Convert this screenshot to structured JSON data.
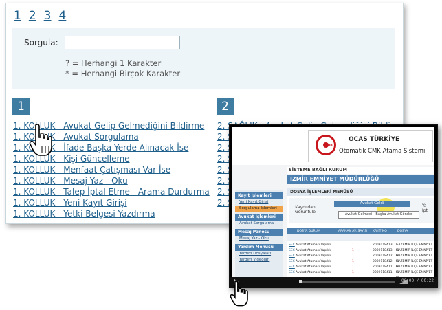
{
  "pager": {
    "pages": [
      "1",
      "2",
      "3",
      "4"
    ]
  },
  "search": {
    "label": "Sorgula:",
    "value": "",
    "hint1": "? = Herhangi 1 Karakter",
    "hint2": "* = Herhangi Birçok Karakter"
  },
  "section1": {
    "badge": "1",
    "items": [
      "1. KOLLUK - Avukat Gelip Gelmediğini Bildirme",
      "1. KOLLUK - Avukat Sorgulama",
      "1. KOLLUK - İfade Başka Yerde Alınacak İse",
      "1. KOLLUK - Kişi Güncelleme",
      "1. KOLLUK - Menfaat Çatışması Var İse",
      "1. KOLLUK - Mesaj Yaz - Oku",
      "1. KOLLUK - Talep İptal Etme - Arama Durdurma",
      "1. KOLLUK - Yeni Kayıt Girişi",
      "1. KOLLUK - Yetki Belgesi Yazdırma"
    ]
  },
  "section2": {
    "badge": "2",
    "items": [
      "2. SAĞLIK - Avukat Gelip Gelmediğini Bildirme",
      "2. S",
      "2. S",
      "2. S",
      "2. S",
      "2. S",
      "2. S",
      "2. S"
    ]
  },
  "video": {
    "logo_title": "OCAS TÜRKİYE",
    "logo_sub": "Otomatik CMK Atama Sistemi",
    "logo_mark": "ocas",
    "top_bar": "SİSTEME BAĞLI KURUM",
    "title_bar": "İZMİR EMNİYET MÜDÜRLÜĞÜ",
    "side_menu": [
      {
        "head": "Kayıt İşlemleri",
        "links": [
          "Yeni Kayıt Girişi",
          "Sorgulama İşlemleri"
        ],
        "active": 1
      },
      {
        "head": "Avukat İşlemleri",
        "links": [
          "Avukat Sorgulama"
        ],
        "active": -1
      },
      {
        "head": "Mesaj Panosu",
        "links": [
          "Mesaj Yaz - Oku"
        ],
        "active": -1
      },
      {
        "head": "Yardım Menüsü",
        "links": [
          "Yardım Dosyaları",
          "Yardım Videoları"
        ],
        "active": -1
      }
    ],
    "dosya_head": "DOSYA İŞLEMLERİ MENÜSÜ",
    "kaydi_label": "Kaydı'dan Görüntüle",
    "btn1": "Avukat Geldi",
    "btn2": "Avukat Gelmedi - Başka Avukat Gönder",
    "right_fragment": "Ya İpt",
    "table_headers": [
      "DOSYA DURUM",
      "ARANAN AV. SAYISI",
      "KAYIT NO",
      "DOSYA"
    ],
    "rows": [
      [
        "SEÇ",
        "Avukat Ataması Yapıldı.",
        "1",
        "2009118413",
        "GAZEMİR İLÇE EMNİYET M"
      ],
      [
        "SEÇ",
        "Avukat Ataması Yapıldı.",
        "1",
        "2009118413",
        "GAZEMİR İLÇE EMNİYET M"
      ],
      [
        "SEÇ",
        "Avukat Ataması Yapıldı.",
        "1",
        "2009118412",
        "GAZEMİR İLÇE EMNİYET M"
      ],
      [
        "SEÇ",
        "Avukat Ataması Yapıldı.",
        "1",
        "2009118412",
        "GAZEMİR İLÇE EMNİYET M"
      ],
      [
        "SEÇ",
        "Avukat Ataması Yapıldı.",
        "1",
        "2009118411",
        "GAZEMİR İLÇE EMNİYET M"
      ],
      [
        "SEÇ",
        "Avukat Ataması Yapıldı.",
        "1",
        "2009118411",
        "GAZEMİR İLÇE EMNİYET M"
      ]
    ],
    "time": "00:00 / 00:22"
  },
  "colors": {
    "accent": "#3f7ca1",
    "link": "#1f5f8b",
    "search_bg": "#eef5f8",
    "brand_red": "#c8161d"
  }
}
